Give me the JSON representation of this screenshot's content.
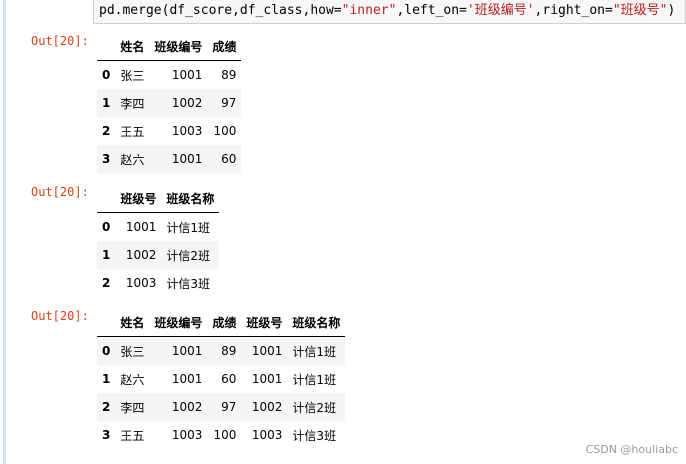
{
  "code": {
    "prefix": "pd.merge(df_score,df_class,how=",
    "how_value": "\"inner\"",
    "mid1": ",left_on=",
    "left_value": "'班级编号'",
    "mid2": ",right_on=",
    "right_value": "\"班级号\"",
    "suffix": ")"
  },
  "outputs": [
    {
      "prompt": "Out[20]:",
      "columns": [
        "",
        "姓名",
        "班级编号",
        "成绩"
      ],
      "rows": [
        [
          "0",
          "张三",
          "1001",
          "89"
        ],
        [
          "1",
          "李四",
          "1002",
          "97"
        ],
        [
          "2",
          "王五",
          "1003",
          "100"
        ],
        [
          "3",
          "赵六",
          "1001",
          "60"
        ]
      ]
    },
    {
      "prompt": "Out[20]:",
      "columns": [
        "",
        "班级号",
        "班级名称"
      ],
      "rows": [
        [
          "0",
          "1001",
          "计信1班"
        ],
        [
          "1",
          "1002",
          "计信2班"
        ],
        [
          "2",
          "1003",
          "计信3班"
        ]
      ]
    },
    {
      "prompt": "Out[20]:",
      "columns": [
        "",
        "姓名",
        "班级编号",
        "成绩",
        "班级号",
        "班级名称"
      ],
      "rows": [
        [
          "0",
          "张三",
          "1001",
          "89",
          "1001",
          "计信1班"
        ],
        [
          "1",
          "赵六",
          "1001",
          "60",
          "1001",
          "计信1班"
        ],
        [
          "2",
          "李四",
          "1002",
          "97",
          "1002",
          "计信2班"
        ],
        [
          "3",
          "王五",
          "1003",
          "100",
          "1003",
          "计信3班"
        ]
      ]
    }
  ],
  "watermark": "CSDN @houliabc"
}
